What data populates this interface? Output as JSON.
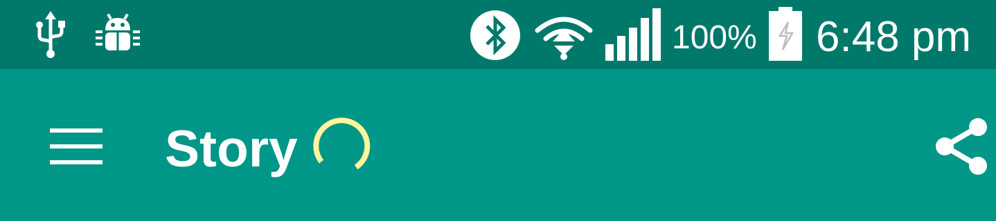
{
  "status_bar": {
    "background": "#00796B",
    "left_icons": [
      "usb-icon",
      "android-debug-icon"
    ],
    "right_icons": [
      "bluetooth-icon",
      "wifi-icon",
      "cell-signal-icon",
      "battery-charging-icon"
    ],
    "battery_percent": "100%",
    "time": "6:48 pm"
  },
  "toolbar": {
    "background": "#009688",
    "menu_icon": "hamburger-menu-icon",
    "title": "Story",
    "loading_indicator_color": "#FFF59D",
    "share_icon": "share-icon"
  }
}
